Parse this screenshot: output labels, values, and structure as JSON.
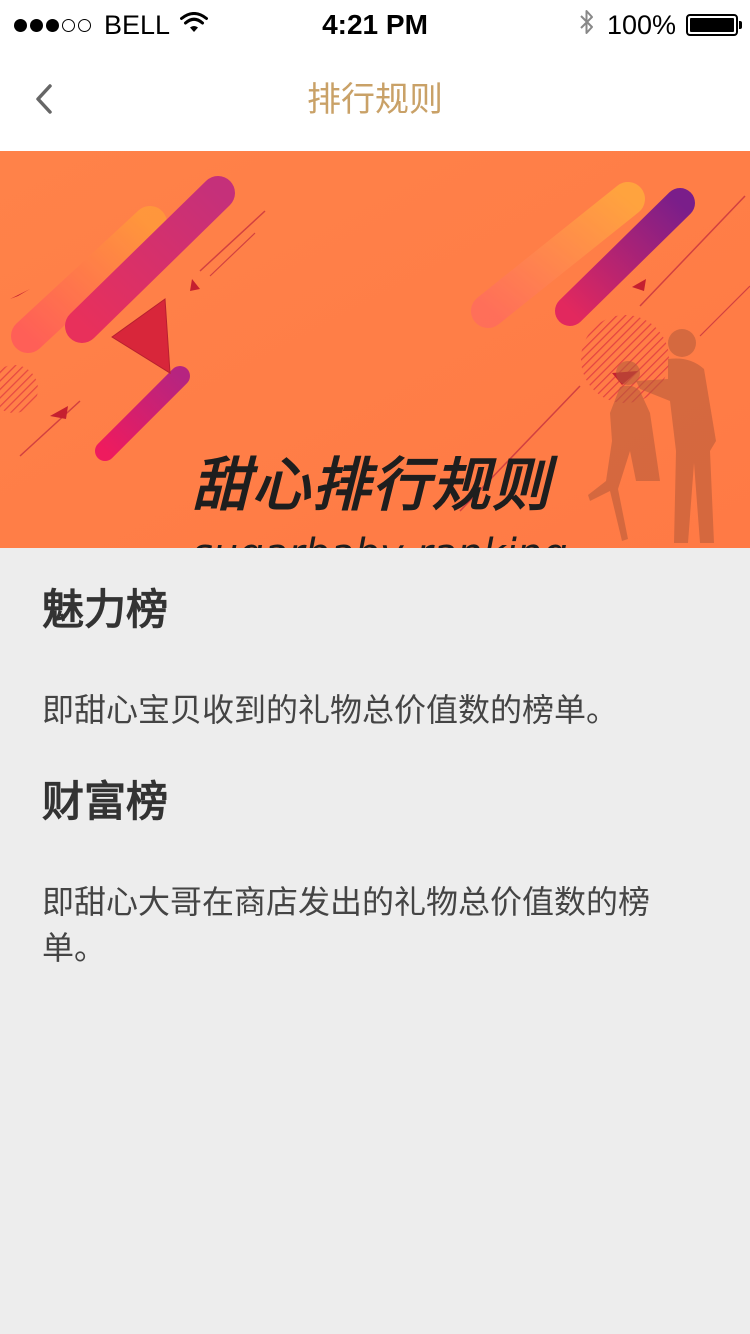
{
  "status_bar": {
    "carrier": "BELL",
    "time": "4:21 PM",
    "battery": "100%",
    "signal_dots": [
      true,
      true,
      true,
      false,
      false
    ],
    "icons": [
      "wifi-icon",
      "bluetooth-icon",
      "battery-icon"
    ]
  },
  "nav": {
    "title": "排行规则",
    "back_icon": "chevron-left-icon"
  },
  "banner": {
    "title": "甜心排行规则",
    "subtitle": "sugarbaby ranking"
  },
  "sections": [
    {
      "title": "魅力榜",
      "description": "即甜心宝贝收到的礼物总价值数的榜单。"
    },
    {
      "title": "财富榜",
      "description": "即甜心大哥在商店发出的礼物总价值数的榜单。"
    }
  ],
  "colors": {
    "nav_title": "#c9a167",
    "banner_bg": "#ff7f45",
    "page_bg": "#ededed"
  }
}
